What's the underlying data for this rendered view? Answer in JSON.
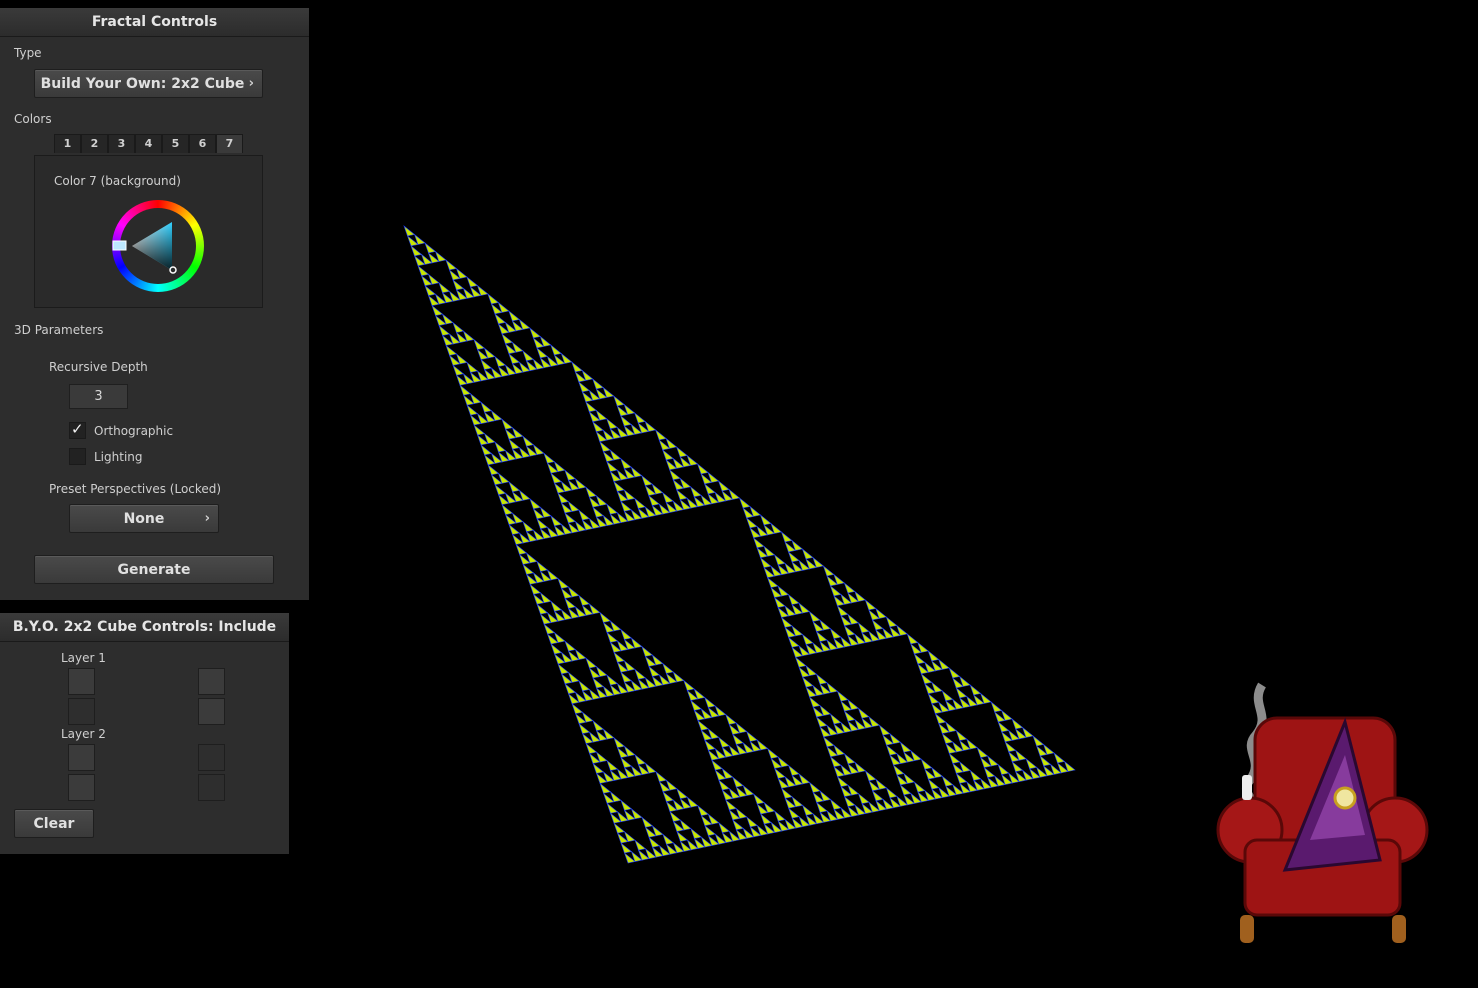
{
  "fractal_controls": {
    "title": "Fractal Controls",
    "type_label": "Type",
    "type_value": "Build Your Own: 2x2 Cube",
    "colors_label": "Colors",
    "color_tabs": [
      "1",
      "2",
      "3",
      "4",
      "5",
      "6",
      "7"
    ],
    "active_color_tab": "7",
    "color_caption": "Color 7 (background)",
    "params_label": "3D Parameters",
    "depth_label": "Recursive Depth",
    "depth_value": "3",
    "orthographic_label": "Orthographic",
    "orthographic_checked": true,
    "lighting_label": "Lighting",
    "lighting_checked": false,
    "perspective_label": "Preset Perspectives (Locked)",
    "perspective_value": "None",
    "generate_label": "Generate"
  },
  "cube_controls": {
    "title": "B.Y.O. 2x2 Cube Controls: Include",
    "layer1_label": "Layer 1",
    "layer2_label": "Layer 2",
    "clear_label": "Clear"
  },
  "colors": {
    "fractal_fill": "#c8e600",
    "fractal_edge": "#2040ff",
    "background": "#000000"
  }
}
